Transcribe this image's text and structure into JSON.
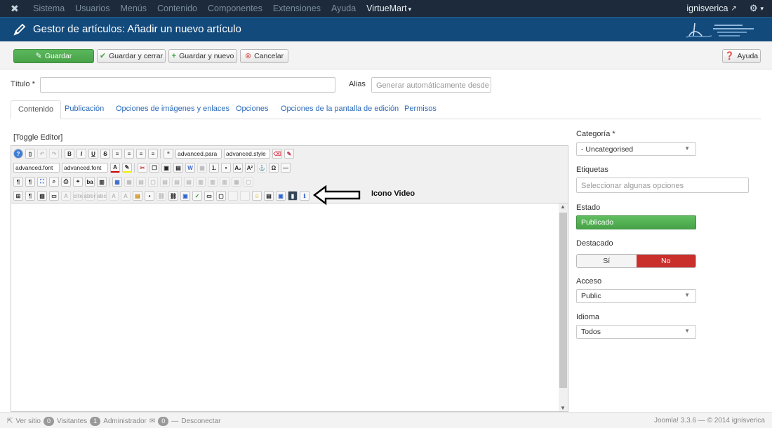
{
  "topnav": {
    "items": [
      "Sistema",
      "Usuarios",
      "Menús",
      "Contenido",
      "Componentes",
      "Extensiones",
      "Ayuda"
    ],
    "virtuemart": "VirtueMart",
    "user": "ignisverica",
    "gear_icon": "gear-icon"
  },
  "header": {
    "title": "Gestor de artículos: Añadir un nuevo artículo"
  },
  "toolbar": {
    "save": "Guardar",
    "save_close": "Guardar y cerrar",
    "save_new": "Guardar y nuevo",
    "cancel": "Cancelar",
    "help": "Ayuda"
  },
  "form": {
    "title_label": "Título *",
    "alias_label": "Alias",
    "alias_placeholder": "Generar automáticamente desde el"
  },
  "tabs": [
    "Contenido",
    "Publicación",
    "Opciones de imágenes y enlaces",
    "Opciones",
    "Opciones de la pantalla de edición",
    "Permisos"
  ],
  "editor": {
    "toggle": "[Toggle Editor]",
    "dd1": "advanced.para",
    "dd2": "advanced.style",
    "dd3": "advanced.font",
    "dd4": "advanced.font",
    "annotation": "Icono Video"
  },
  "sidebar": {
    "categoria_label": "Categoría *",
    "categoria_value": "- Uncategorised",
    "etiquetas_label": "Etiquetas",
    "etiquetas_placeholder": "Seleccionar algunas opciones",
    "estado_label": "Estado",
    "estado_value": "Publicado",
    "destacado_label": "Destacado",
    "destacado_si": "Sí",
    "destacado_no": "No",
    "acceso_label": "Acceso",
    "acceso_value": "Public",
    "idioma_label": "Idioma",
    "idioma_value": "Todos"
  },
  "footer": {
    "ver_sitio": "Ver sitio",
    "visitantes_count": "0",
    "visitantes": "Visitantes",
    "admin_count": "1",
    "admin": "Administrador",
    "mail_count": "0",
    "desconectar": "Desconectar",
    "version": "Joomla! 3.3.6 — © 2014 ignisverica"
  }
}
